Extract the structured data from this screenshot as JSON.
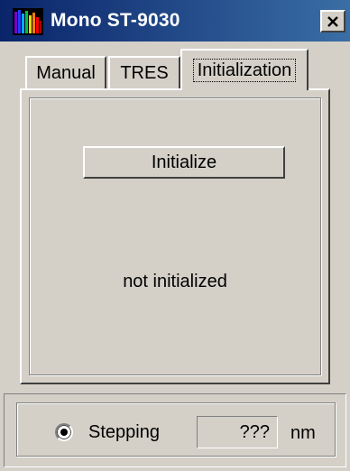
{
  "window": {
    "title": "Mono ST-9030",
    "icon": "spectrum-bars-icon",
    "close_glyph": "×"
  },
  "tabs": [
    {
      "label": "Manual",
      "selected": false
    },
    {
      "label": "TRES",
      "selected": false
    },
    {
      "label": "Initialization",
      "selected": true
    }
  ],
  "initialization": {
    "button_label": "Initialize",
    "status": "not initialized"
  },
  "footer": {
    "mode_label": "Stepping",
    "mode_selected": true,
    "wavelength_value": "???",
    "unit": "nm"
  },
  "colors": {
    "titlebar_start": "#0a246a",
    "titlebar_end": "#3a6ea5",
    "face": "#d4d0c8"
  }
}
